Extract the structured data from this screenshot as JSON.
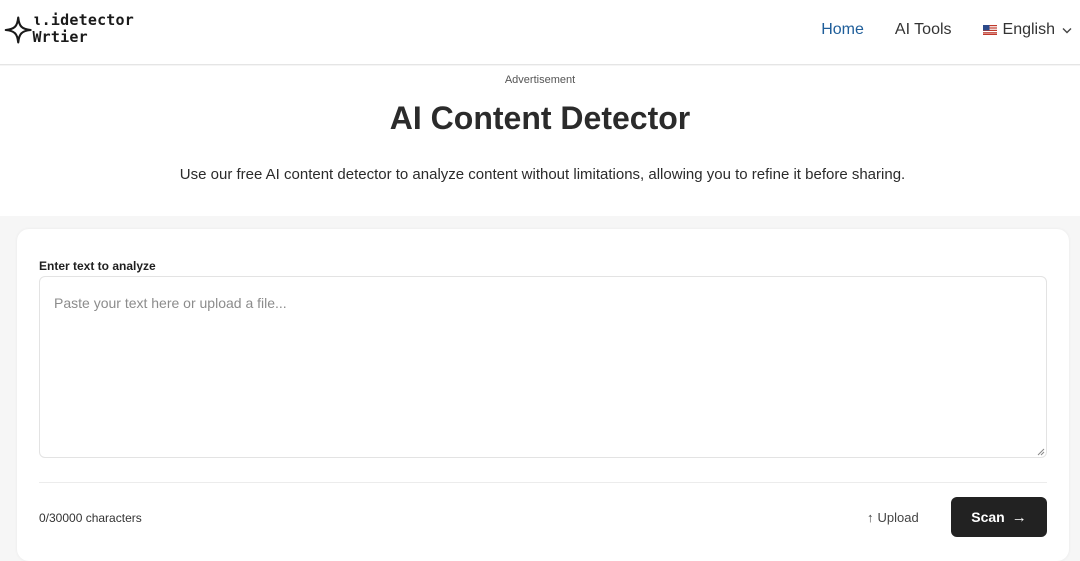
{
  "header": {
    "logo_line1": "ι.idetector",
    "logo_line2": "Wrtier",
    "nav": {
      "home": "Home",
      "ai_tools": "AI Tools",
      "language": "English"
    },
    "colors": {
      "active_link": "#1f5e9a"
    },
    "icons": {
      "flag": "us-flag-icon",
      "dropdown": "chevron-down-icon"
    }
  },
  "main": {
    "advertisement": "Advertisement",
    "title": "AI Content Detector",
    "subtitle": "Use our free AI content detector to analyze content without limitations, allowing you to refine it before sharing."
  },
  "analyzer": {
    "label": "Enter text to analyze",
    "input_value": "",
    "placeholder": "Paste your text here or upload a file...",
    "char_count": "0/30000 characters",
    "upload_label": "Upload",
    "upload_icon": "↑",
    "scan_label": "Scan",
    "scan_icon": "→",
    "colors": {
      "scan_bg": "#222222"
    }
  }
}
